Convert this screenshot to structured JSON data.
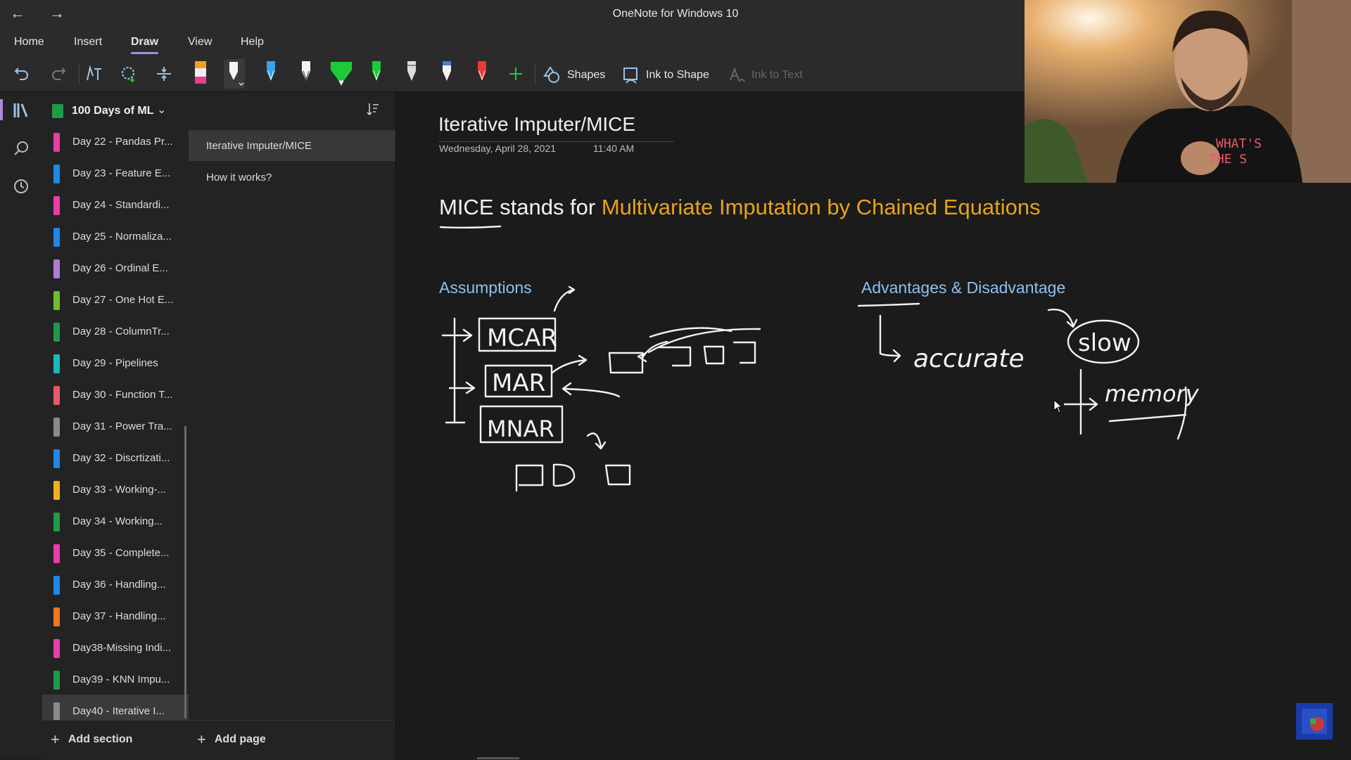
{
  "window": {
    "title": "OneNote for Windows 10"
  },
  "menu": {
    "items": [
      "Home",
      "Insert",
      "Draw",
      "View",
      "Help"
    ],
    "active": "Draw"
  },
  "toolbar": {
    "shapes_label": "Shapes",
    "ink_to_shape_label": "Ink to Shape",
    "ink_to_text_label": "Ink to Text",
    "pen_colors": [
      "#e83e8c",
      "#ffffff",
      "#3aa0e8",
      "#ffffff",
      "#1ec93a",
      "#1ec93a",
      "#ffffff",
      "#4a7ec9",
      "#e83a3a"
    ]
  },
  "notebook": {
    "name": "100 Days of ML"
  },
  "sections": [
    {
      "label": "Day 22 - Pandas Pr...",
      "color": "#e83ea8"
    },
    {
      "label": "Day 23 - Feature E...",
      "color": "#1e88e5"
    },
    {
      "label": "Day 24 - Standardi...",
      "color": "#e83ea8"
    },
    {
      "label": "Day 25 - Normaliza...",
      "color": "#1e88e5"
    },
    {
      "label": "Day 26 - Ordinal E...",
      "color": "#b07ad8"
    },
    {
      "label": "Day 27 - One Hot E...",
      "color": "#6fbf2a"
    },
    {
      "label": "Day 28 - ColumnTr...",
      "color": "#1e9b48"
    },
    {
      "label": "Day 29 - Pipelines",
      "color": "#1eb8b8"
    },
    {
      "label": "Day 30 - Function T...",
      "color": "#e85a6a"
    },
    {
      "label": "Day 31 - Power Tra...",
      "color": "#8a8a8a"
    },
    {
      "label": "Day 32 - Discrtizati...",
      "color": "#1e88e5"
    },
    {
      "label": "Day 33 - Working-...",
      "color": "#f2b01e"
    },
    {
      "label": "Day 34 - Working...",
      "color": "#1e9b48"
    },
    {
      "label": "Day 35 - Complete...",
      "color": "#e83ea8"
    },
    {
      "label": "Day 36 - Handling...",
      "color": "#1e88e5"
    },
    {
      "label": "Day 37 - Handling...",
      "color": "#f0781e"
    },
    {
      "label": "Day38-Missing Indi...",
      "color": "#e83ea8"
    },
    {
      "label": "Day39 - KNN Impu...",
      "color": "#1e9b48"
    },
    {
      "label": "Day40 - Iterative I...",
      "color": "#8a8a8a"
    }
  ],
  "selected_section_index": 18,
  "pages": [
    {
      "label": "Iterative Imputer/MICE"
    },
    {
      "label": "How it works?"
    }
  ],
  "selected_page_index": 0,
  "bottom": {
    "add_section": "Add section",
    "add_page": "Add page"
  },
  "note": {
    "title": "Iterative Imputer/MICE",
    "date": "Wednesday, April 28, 2021",
    "time": "11:40 AM",
    "heading_part1": "MICE stands for ",
    "heading_part2": "Multivariate Imputation by Chained Equations",
    "assumptions": "Assumptions",
    "adv_disadv": "Advantages & Disadvantage",
    "ink": {
      "mcar": "MCAR",
      "mar": "MAR",
      "mnar": "MNAR",
      "accurate": "accurate",
      "slow": "slow",
      "memory": "memory"
    }
  },
  "webcam": {
    "shirt_text_1": "WHAT'S",
    "shirt_text_2": "THE S"
  }
}
